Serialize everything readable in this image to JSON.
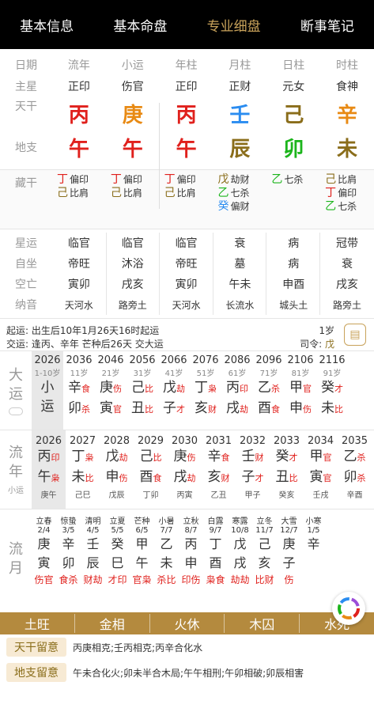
{
  "tabs": [
    "基本信息",
    "基本命盘",
    "专业细盘",
    "断事笔记"
  ],
  "pillars": {
    "headers": [
      "日期",
      "流年",
      "小运",
      "年柱",
      "月柱",
      "日柱",
      "时柱"
    ],
    "stars_label": "主星",
    "stars": [
      "正印",
      "伤官",
      "正印",
      "正财",
      "元女",
      "食神"
    ],
    "tiangan_label": "天干",
    "tiangan": [
      "丙",
      "庚",
      "丙",
      "壬",
      "己",
      "辛"
    ],
    "tiangan_colors": [
      "#e0201c",
      "#e88a14",
      "#e0201c",
      "#2a8cf0",
      "#8a6d1a",
      "#e88a14"
    ],
    "dizhi_label": "地支",
    "dizhi": [
      "午",
      "午",
      "午",
      "辰",
      "卯",
      "未"
    ],
    "dizhi_colors": [
      "#e0201c",
      "#e0201c",
      "#e0201c",
      "#8a6d1a",
      "#1cb51c",
      "#8a6d1a"
    ]
  },
  "canggan": {
    "label": "藏干",
    "cols": [
      [
        {
          "g": "丁",
          "c": "#e0201c",
          "s": "偏印"
        },
        {
          "g": "己",
          "c": "#8a6d1a",
          "s": "比肩"
        }
      ],
      [
        {
          "g": "丁",
          "c": "#e0201c",
          "s": "偏印"
        },
        {
          "g": "己",
          "c": "#8a6d1a",
          "s": "比肩"
        }
      ],
      [
        {
          "g": "丁",
          "c": "#e0201c",
          "s": "偏印"
        },
        {
          "g": "己",
          "c": "#8a6d1a",
          "s": "比肩"
        }
      ],
      [
        {
          "g": "戊",
          "c": "#8a6d1a",
          "s": "劫财"
        },
        {
          "g": "乙",
          "c": "#1cb51c",
          "s": "七杀"
        },
        {
          "g": "癸",
          "c": "#2a8cf0",
          "s": "偏财"
        }
      ],
      [
        {
          "g": "乙",
          "c": "#1cb51c",
          "s": "七杀"
        }
      ],
      [
        {
          "g": "己",
          "c": "#8a6d1a",
          "s": "比肩"
        },
        {
          "g": "丁",
          "c": "#e0201c",
          "s": "偏印"
        },
        {
          "g": "乙",
          "c": "#1cb51c",
          "s": "七杀"
        }
      ]
    ]
  },
  "misc": {
    "rows": [
      {
        "label": "星运",
        "vals": [
          "临官",
          "临官",
          "临官",
          "衰",
          "病",
          "冠带"
        ]
      },
      {
        "label": "自坐",
        "vals": [
          "帝旺",
          "沐浴",
          "帝旺",
          "墓",
          "病",
          "衰"
        ]
      },
      {
        "label": "空亡",
        "vals": [
          "寅卯",
          "戌亥",
          "寅卯",
          "午未",
          "申酉",
          "戌亥"
        ]
      },
      {
        "label": "纳音",
        "vals": [
          "天河水",
          "路旁土",
          "天河水",
          "长流水",
          "城头土",
          "路旁土"
        ]
      }
    ]
  },
  "info": {
    "qiyun": "起运:   出生后10年1月26天16时起运",
    "jiaoyun": "交运:   逢丙、辛年 芒种后26天 交大运",
    "age": "1岁",
    "siling_label": "司令:",
    "siling": "戊"
  },
  "dayun": {
    "label": [
      "大",
      "运"
    ],
    "items": [
      {
        "yr": "2026",
        "age": "1-10岁",
        "g": "小",
        "z": "运",
        "gs": "",
        "zs": ""
      },
      {
        "yr": "2036",
        "age": "11岁",
        "g": "辛",
        "gs": "食",
        "gc": "#e0201c",
        "z": "卯",
        "zs": "杀",
        "zc": "#e0201c"
      },
      {
        "yr": "2046",
        "age": "21岁",
        "g": "庚",
        "gs": "伤",
        "gc": "#e0201c",
        "z": "寅",
        "zs": "官",
        "zc": "#e0201c"
      },
      {
        "yr": "2056",
        "age": "31岁",
        "g": "己",
        "gs": "比",
        "gc": "#e0201c",
        "z": "丑",
        "zs": "比",
        "zc": "#e0201c"
      },
      {
        "yr": "2066",
        "age": "41岁",
        "g": "戊",
        "gs": "劫",
        "gc": "#e0201c",
        "z": "子",
        "zs": "才",
        "zc": "#e0201c"
      },
      {
        "yr": "2076",
        "age": "51岁",
        "g": "丁",
        "gs": "枭",
        "gc": "#e0201c",
        "z": "亥",
        "zs": "财",
        "zc": "#e0201c"
      },
      {
        "yr": "2086",
        "age": "61岁",
        "g": "丙",
        "gs": "印",
        "gc": "#e0201c",
        "z": "戌",
        "zs": "劫",
        "zc": "#e0201c"
      },
      {
        "yr": "2096",
        "age": "71岁",
        "g": "乙",
        "gs": "杀",
        "gc": "#e0201c",
        "z": "酉",
        "zs": "食",
        "zc": "#e0201c"
      },
      {
        "yr": "2106",
        "age": "81岁",
        "g": "甲",
        "gs": "官",
        "gc": "#e0201c",
        "z": "申",
        "zs": "伤",
        "zc": "#e0201c"
      },
      {
        "yr": "2116",
        "age": "91岁",
        "g": "癸",
        "gs": "才",
        "gc": "#e0201c",
        "z": "未",
        "zs": "比",
        "zc": "#e0201c"
      }
    ]
  },
  "liunian": {
    "label": [
      "流",
      "年"
    ],
    "sub": "小运",
    "items": [
      {
        "yr": "2026",
        "g": "丙",
        "gs": "印",
        "z": "午",
        "zs": "枭",
        "nm": "庚午"
      },
      {
        "yr": "2027",
        "g": "丁",
        "gs": "枭",
        "z": "未",
        "zs": "比",
        "nm": "己巳"
      },
      {
        "yr": "2028",
        "g": "戊",
        "gs": "劫",
        "z": "申",
        "zs": "伤",
        "nm": "戊辰"
      },
      {
        "yr": "2029",
        "g": "己",
        "gs": "比",
        "z": "酉",
        "zs": "食",
        "nm": "丁卯"
      },
      {
        "yr": "2030",
        "g": "庚",
        "gs": "伤",
        "z": "戌",
        "zs": "劫",
        "nm": "丙寅"
      },
      {
        "yr": "2031",
        "g": "辛",
        "gs": "食",
        "z": "亥",
        "zs": "财",
        "nm": "乙丑"
      },
      {
        "yr": "2032",
        "g": "壬",
        "gs": "财",
        "z": "子",
        "zs": "才",
        "nm": "甲子"
      },
      {
        "yr": "2033",
        "g": "癸",
        "gs": "才",
        "z": "丑",
        "zs": "比",
        "nm": "癸亥"
      },
      {
        "yr": "2034",
        "g": "甲",
        "gs": "官",
        "z": "寅",
        "zs": "官",
        "nm": "壬戌"
      },
      {
        "yr": "2035",
        "g": "乙",
        "gs": "杀",
        "z": "卯",
        "zs": "杀",
        "nm": "辛酉"
      }
    ]
  },
  "liuyue": {
    "label": [
      "流",
      "月"
    ],
    "items": [
      {
        "jq": "立春",
        "dt": "2/4",
        "g": "庚",
        "z": "寅",
        "ss": "伤官"
      },
      {
        "jq": "惊蛰",
        "dt": "3/5",
        "g": "辛",
        "z": "卯",
        "ss": "食杀"
      },
      {
        "jq": "清明",
        "dt": "4/5",
        "g": "壬",
        "z": "辰",
        "ss": "财劫"
      },
      {
        "jq": "立夏",
        "dt": "5/5",
        "g": "癸",
        "z": "巳",
        "ss": "才印"
      },
      {
        "jq": "芒种",
        "dt": "6/5",
        "g": "甲",
        "z": "午",
        "ss": "官枭"
      },
      {
        "jq": "小暑",
        "dt": "7/7",
        "g": "乙",
        "z": "未",
        "ss": "杀比"
      },
      {
        "jq": "立秋",
        "dt": "8/7",
        "g": "丙",
        "z": "申",
        "ss": "印伤"
      },
      {
        "jq": "白露",
        "dt": "9/7",
        "g": "丁",
        "z": "酉",
        "ss": "枭食"
      },
      {
        "jq": "寒露",
        "dt": "10/8",
        "g": "戊",
        "z": "戌",
        "ss": "劫劫"
      },
      {
        "jq": "立冬",
        "dt": "11/7",
        "g": "己",
        "z": "亥",
        "ss": "比财"
      },
      {
        "jq": "大雪",
        "dt": "12/7",
        "g": "庚",
        "z": "子",
        "ss": "伤"
      },
      {
        "jq": "小寒",
        "dt": "1/5",
        "g": "辛",
        "z": "",
        "ss": ""
      }
    ]
  },
  "wuxing": [
    "土旺",
    "金相",
    "火休",
    "木囚",
    "水死"
  ],
  "notes": [
    {
      "tag": "天干留意",
      "text": "丙庚相克;壬丙相克;丙辛合化水"
    },
    {
      "tag": "地支留意",
      "text": "午未合化火;卯未半合木局;午午相刑;午卯相破;卯辰相害"
    }
  ]
}
